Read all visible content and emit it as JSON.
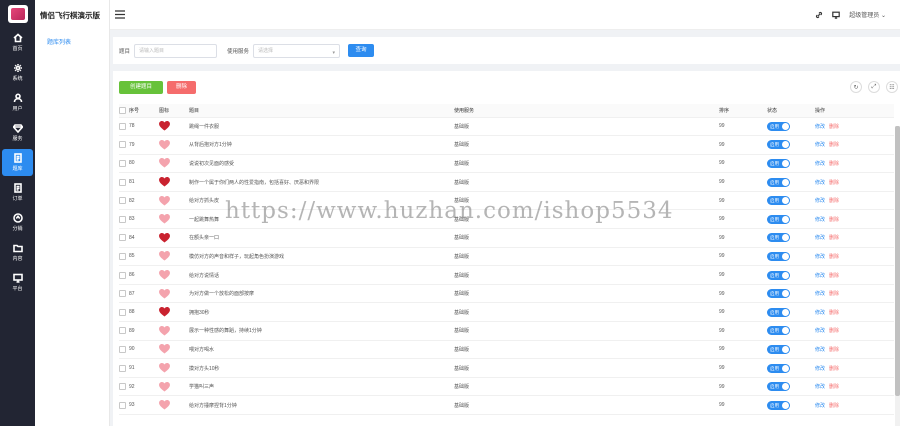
{
  "app": {
    "title": "情侣飞行棋演示版"
  },
  "rail": {
    "items": [
      {
        "label": "首页",
        "icon": "home-icon"
      },
      {
        "label": "系统",
        "icon": "gear-icon"
      },
      {
        "label": "用户",
        "icon": "user-icon"
      },
      {
        "label": "服务",
        "icon": "diamond-icon"
      },
      {
        "label": "题库",
        "icon": "document-icon",
        "active": true
      },
      {
        "label": "订单",
        "icon": "document-icon"
      },
      {
        "label": "分销",
        "icon": "share-icon"
      },
      {
        "label": "内容",
        "icon": "folder-icon"
      },
      {
        "label": "平台",
        "icon": "monitor-icon"
      }
    ]
  },
  "submenu": {
    "items": [
      {
        "label": "题库列表"
      }
    ]
  },
  "header": {
    "user": "超级管理员"
  },
  "filter": {
    "title_label": "题目",
    "title_placeholder": "请输入题目",
    "service_label": "使用服务",
    "service_placeholder": "请选择",
    "query_label": "查询"
  },
  "toolbar": {
    "create_label": "创建题目",
    "delete_label": "删除"
  },
  "table": {
    "headers": [
      "序号",
      "图标",
      "题目",
      "使用服务",
      "排序",
      "状态",
      "操作"
    ],
    "toggle_label": "启用",
    "edit_label": "修改",
    "delete_label": "删除",
    "rows": [
      {
        "id": "78",
        "title": "跳绳一件衣服",
        "service": "基础版",
        "sort": "99",
        "heart": "#c9222f"
      },
      {
        "id": "79",
        "title": "从背后抱对方1分钟",
        "service": "基础版",
        "sort": "99",
        "heart": "#f4a3ad"
      },
      {
        "id": "80",
        "title": "说说初次见面的感受",
        "service": "基础版",
        "sort": "99",
        "heart": "#f4a3ad"
      },
      {
        "id": "81",
        "title": "制作一个属于你们两人的性爱指南，包括喜好、厌恶和界限",
        "service": "基础版",
        "sort": "99",
        "heart": "#c9222f"
      },
      {
        "id": "82",
        "title": "给对方抓头皮",
        "service": "基础版",
        "sort": "99",
        "heart": "#f4a3ad"
      },
      {
        "id": "83",
        "title": "一起跳舞热舞",
        "service": "基础版",
        "sort": "99",
        "heart": "#f4a3ad"
      },
      {
        "id": "84",
        "title": "在额头亲一口",
        "service": "基础版",
        "sort": "99",
        "heart": "#c9222f"
      },
      {
        "id": "85",
        "title": "模仿对方的声音和样子，玩起角色扮演游戏",
        "service": "基础版",
        "sort": "99",
        "heart": "#f4a3ad"
      },
      {
        "id": "86",
        "title": "给对方说情话",
        "service": "基础版",
        "sort": "99",
        "heart": "#f4a3ad"
      },
      {
        "id": "87",
        "title": "为对方做一个放松的面部按摩",
        "service": "基础版",
        "sort": "99",
        "heart": "#f4a3ad"
      },
      {
        "id": "88",
        "title": "拥抱30秒",
        "service": "基础版",
        "sort": "99",
        "heart": "#c9222f"
      },
      {
        "id": "89",
        "title": "展示一种性感的舞蹈，持续1分钟",
        "service": "基础版",
        "sort": "99",
        "heart": "#f4a3ad"
      },
      {
        "id": "90",
        "title": "喂对方喝水",
        "service": "基础版",
        "sort": "99",
        "heart": "#f4a3ad"
      },
      {
        "id": "91",
        "title": "摸对方头10秒",
        "service": "基础版",
        "sort": "99",
        "heart": "#f4a3ad"
      },
      {
        "id": "92",
        "title": "学猫叫三声",
        "service": "基础版",
        "sort": "99",
        "heart": "#f4a3ad"
      },
      {
        "id": "93",
        "title": "给对方捶摩捏背1分钟",
        "service": "基础版",
        "sort": "99",
        "heart": "#f4a3ad"
      }
    ]
  },
  "watermark": "https://www.huzhan.com/ishop5534",
  "colors": {
    "primary": "#2d8cf0",
    "green": "#67c23a",
    "red": "#f56c6c",
    "rail": "#222533"
  }
}
